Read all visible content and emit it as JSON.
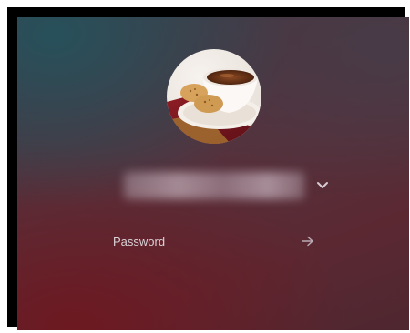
{
  "login": {
    "avatar_icon": "user-avatar-coffee-cup",
    "user_dropdown_icon": "chevron-down-icon",
    "password": {
      "placeholder": "Password",
      "value": ""
    },
    "submit_icon": "arrow-right-icon"
  },
  "colors": {
    "background_top_left": "#26525c",
    "background_mid": "#55323d",
    "background_bottom": "#6e1820",
    "text": "#d9d2d7",
    "frame": "#000000"
  }
}
